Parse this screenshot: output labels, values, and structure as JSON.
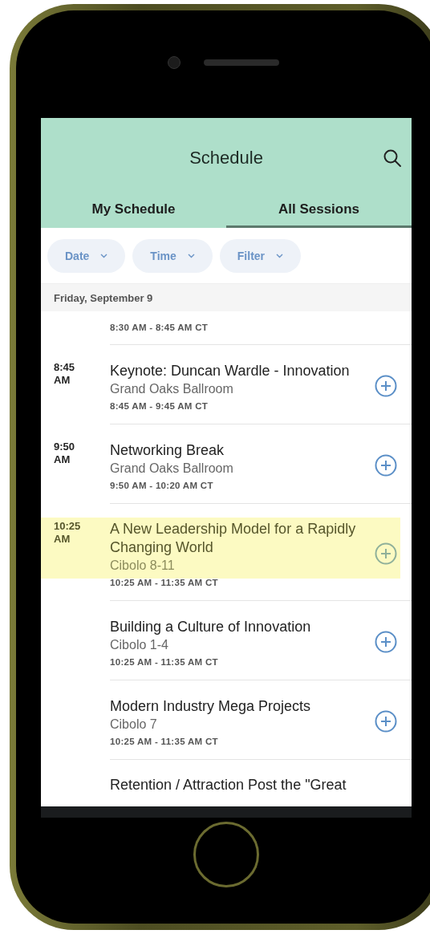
{
  "header": {
    "title": "Schedule"
  },
  "tabs": [
    {
      "label": "My Schedule",
      "selected": false
    },
    {
      "label": "All Sessions",
      "selected": true
    }
  ],
  "filters": [
    {
      "label": "Date"
    },
    {
      "label": "Time"
    },
    {
      "label": "Filter"
    }
  ],
  "date_header": "Friday, September 9",
  "sessions": [
    {
      "kind": "partial-top",
      "times": "8:30 AM - 8:45 AM CT"
    },
    {
      "kind": "full",
      "start": "8:45 AM",
      "title": "Keynote: Duncan Wardle - Innovation",
      "room": "Grand Oaks Ballroom",
      "times": "8:45 AM - 9:45 AM CT",
      "highlighted": false
    },
    {
      "kind": "full",
      "start": "9:50 AM",
      "title": "Networking Break",
      "room": "Grand Oaks Ballroom",
      "times": "9:50 AM - 10:20 AM CT",
      "highlighted": false
    },
    {
      "kind": "full",
      "start": "10:25 AM",
      "title": "A New Leadership Model for a Rapidly Changing World",
      "room": "Cibolo 8-11",
      "times": "10:25 AM - 11:35 AM CT",
      "highlighted": true
    },
    {
      "kind": "full",
      "title": "Building a Culture of Innovation",
      "room": "Cibolo 1-4",
      "times": "10:25 AM - 11:35 AM CT",
      "highlighted": false
    },
    {
      "kind": "full",
      "title": "Modern Industry Mega Projects",
      "room": "Cibolo 7",
      "times": "10:25 AM - 11:35 AM CT",
      "highlighted": false
    },
    {
      "kind": "partial-bottom",
      "title": "Retention / Attraction Post the \"Great"
    }
  ]
}
